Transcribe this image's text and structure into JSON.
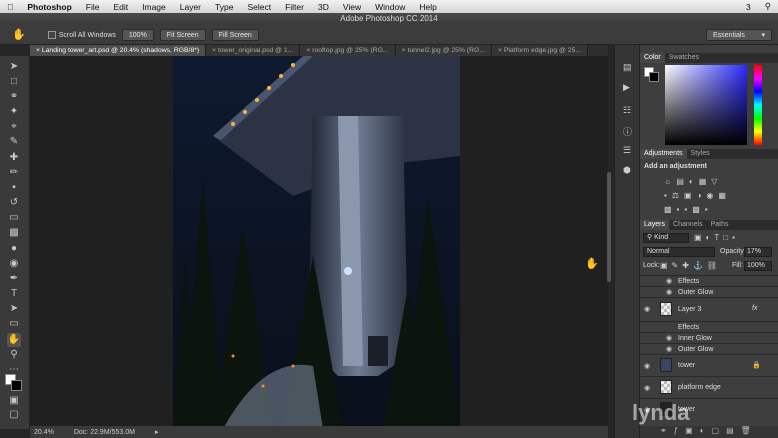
{
  "menubar": {
    "apple": "",
    "items": [
      "Photoshop",
      "File",
      "Edit",
      "Image",
      "Layer",
      "Type",
      "Select",
      "Filter",
      "3D",
      "View",
      "Window",
      "Help"
    ],
    "right": "3"
  },
  "title": "Adobe Photoshop CC 2014",
  "options": {
    "scroll_all": "Scroll All Windows",
    "zoom100": "100%",
    "fit": "Fit Screen",
    "fill": "Fill Screen",
    "workspace": "Essentials"
  },
  "tabs": [
    "Landing tower_art.psd @ 20.4% (shadows, RGB/8*)",
    "tower_original.psd @ 1...",
    "rooftop.jpg @ 25% (RG...",
    "tunnel2.jpg @ 25% (RG...",
    "Platform edge.jpg @ 25..."
  ],
  "status": {
    "zoom": "20.4%",
    "doc": "Doc: 22.9M/553.0M"
  },
  "color_panel": {
    "tabs": [
      "Color",
      "Swatches"
    ]
  },
  "adjustments_panel": {
    "tabs": [
      "Adjustments",
      "Styles"
    ],
    "hint": "Add an adjustment"
  },
  "layers_panel": {
    "tabs": [
      "Layers",
      "Channels",
      "Paths"
    ],
    "kind": "Kind",
    "blend": "Normal",
    "opacity_label": "Opacity:",
    "opacity": "17%",
    "lock_label": "Lock:",
    "fill_label": "Fill:",
    "fill": "100%",
    "rows": [
      {
        "name": "Effects"
      },
      {
        "name": "Outer Glow"
      },
      {
        "name": "Layer 3"
      },
      {
        "name": "Effects"
      },
      {
        "name": "Inner Glow"
      },
      {
        "name": "Outer Glow"
      },
      {
        "name": "tower"
      },
      {
        "name": "platform edge"
      },
      {
        "name": "tower"
      }
    ]
  },
  "watermark": "lynda"
}
